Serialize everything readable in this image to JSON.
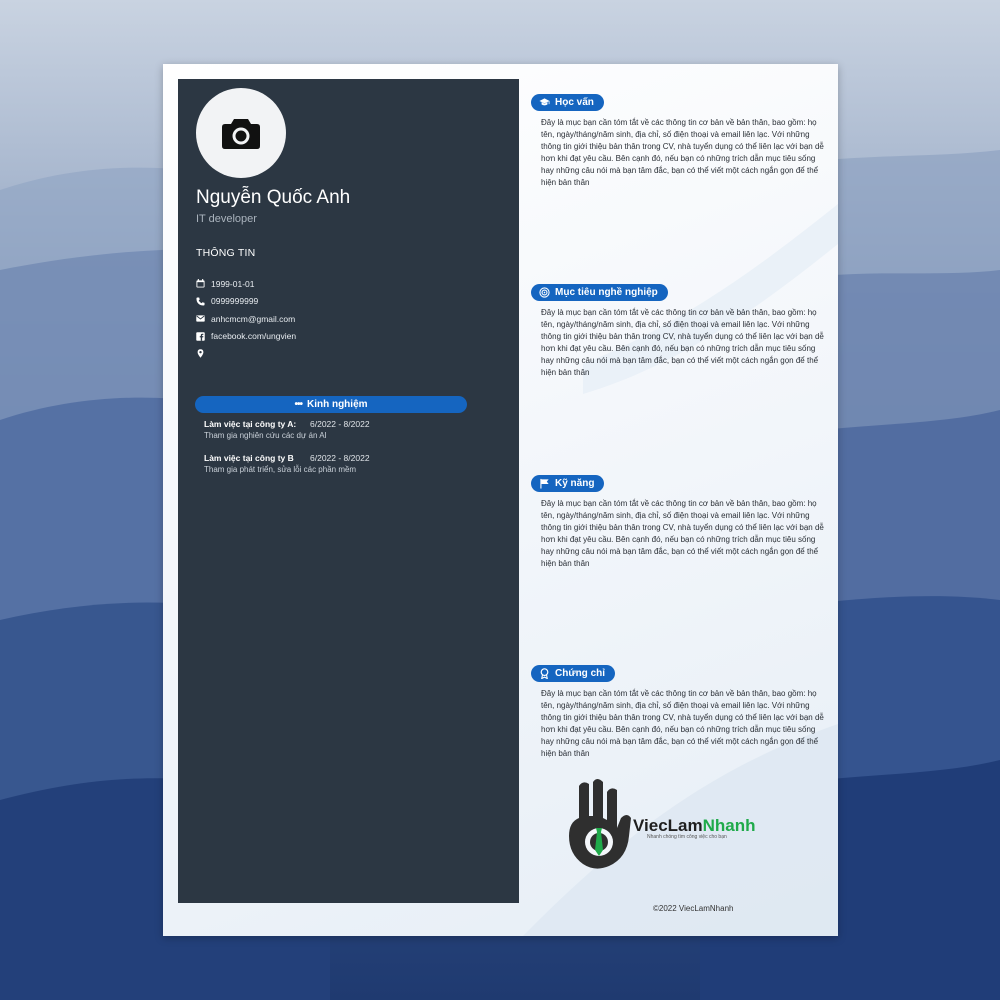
{
  "profile": {
    "name": "Nguyễn Quốc Anh",
    "role": "IT developer",
    "info_title": "THÔNG TIN",
    "contacts": [
      {
        "icon": "calendar-icon",
        "text": "1999-01-01"
      },
      {
        "icon": "phone-icon",
        "text": "0999999999"
      },
      {
        "icon": "mail-icon",
        "text": "anhcmcm@gmail.com"
      },
      {
        "icon": "facebook-icon",
        "text": "facebook.com/ungvien"
      },
      {
        "icon": "location-icon",
        "text": ""
      }
    ]
  },
  "experience": {
    "title": "Kinh nghiệm",
    "items": [
      {
        "company": "Làm việc tại công ty A:",
        "period": "6/2022 - 8/2022",
        "desc": "Tham gia nghiên cứu các dự án AI"
      },
      {
        "company": "Làm việc tại công ty B",
        "period": "6/2022 - 8/2022",
        "desc": "Tham gia phát triển, sửa lỗi các phần mềm"
      }
    ]
  },
  "sections": [
    {
      "title": "Học vấn",
      "icon": "graduation-cap-icon",
      "body": "Đây là mục bạn cần tóm tắt về các thông tin cơ bản về bản thân, bao gồm: họ tên, ngày/tháng/năm sinh, địa chỉ, số điện thoại và email liên lạc. Với những thông tin giới thiệu bản thân trong CV, nhà tuyển dụng có thể liên lạc với bạn dễ hơn khi đạt yêu cầu. Bên cạnh đó, nếu bạn có những trích dẫn mục tiêu sống hay những câu nói mà bạn tâm đắc, bạn có thể viết một cách ngắn gọn để thể hiện bản thân"
    },
    {
      "title": "Mục tiêu nghề nghiệp",
      "icon": "target-icon",
      "body": "Đây là mục bạn cần tóm tắt về các thông tin cơ bản về bản thân, bao gồm: họ tên, ngày/tháng/năm sinh, địa chỉ, số điện thoại và email liên lạc. Với những thông tin giới thiệu bản thân trong CV, nhà tuyển dụng có thể liên lạc với bạn dễ hơn khi đạt yêu cầu. Bên cạnh đó, nếu bạn có những trích dẫn mục tiêu sống hay những câu nói mà bạn tâm đắc, bạn có thể viết một cách ngắn gọn để thể hiện bản thân"
    },
    {
      "title": "Kỹ năng",
      "icon": "flag-icon",
      "body": "Đây là mục bạn cần tóm tắt về các thông tin cơ bản về bản thân, bao gồm: họ tên, ngày/tháng/năm sinh, địa chỉ, số điện thoại và email liên lạc. Với những thông tin giới thiệu bản thân trong CV, nhà tuyển dụng có thể liên lạc với bạn dễ hơn khi đạt yêu cầu. Bên cạnh đó, nếu bạn có những trích dẫn mục tiêu sống hay những câu nói mà bạn tâm đắc, bạn có thể viết một cách ngắn gọn để thể hiện bản thân"
    },
    {
      "title": "Chứng chỉ",
      "icon": "award-icon",
      "body": "Đây là mục bạn cần tóm tắt về các thông tin cơ bản về bản thân, bao gồm: họ tên, ngày/tháng/năm sinh, địa chỉ, số điện thoại và email liên lạc. Với những thông tin giới thiệu bản thân trong CV, nhà tuyển dụng có thể liên lạc với bạn dễ hơn khi đạt yêu cầu. Bên cạnh đó, nếu bạn có những trích dẫn mục tiêu sống hay những câu nói mà bạn tâm đắc, bạn có thể viết một cách ngắn gọn để thể hiện bản thân"
    }
  ],
  "brand": {
    "name_part1": "ViecLam",
    "name_part2": "Nhanh",
    "tagline": "Nhanh chóng tìm công việc cho bạn"
  },
  "footer": "©2022 ViecLamNhanh",
  "colors": {
    "sidebar": "#2c3743",
    "accent": "#1565c0",
    "brand_green": "#1faa4a"
  }
}
